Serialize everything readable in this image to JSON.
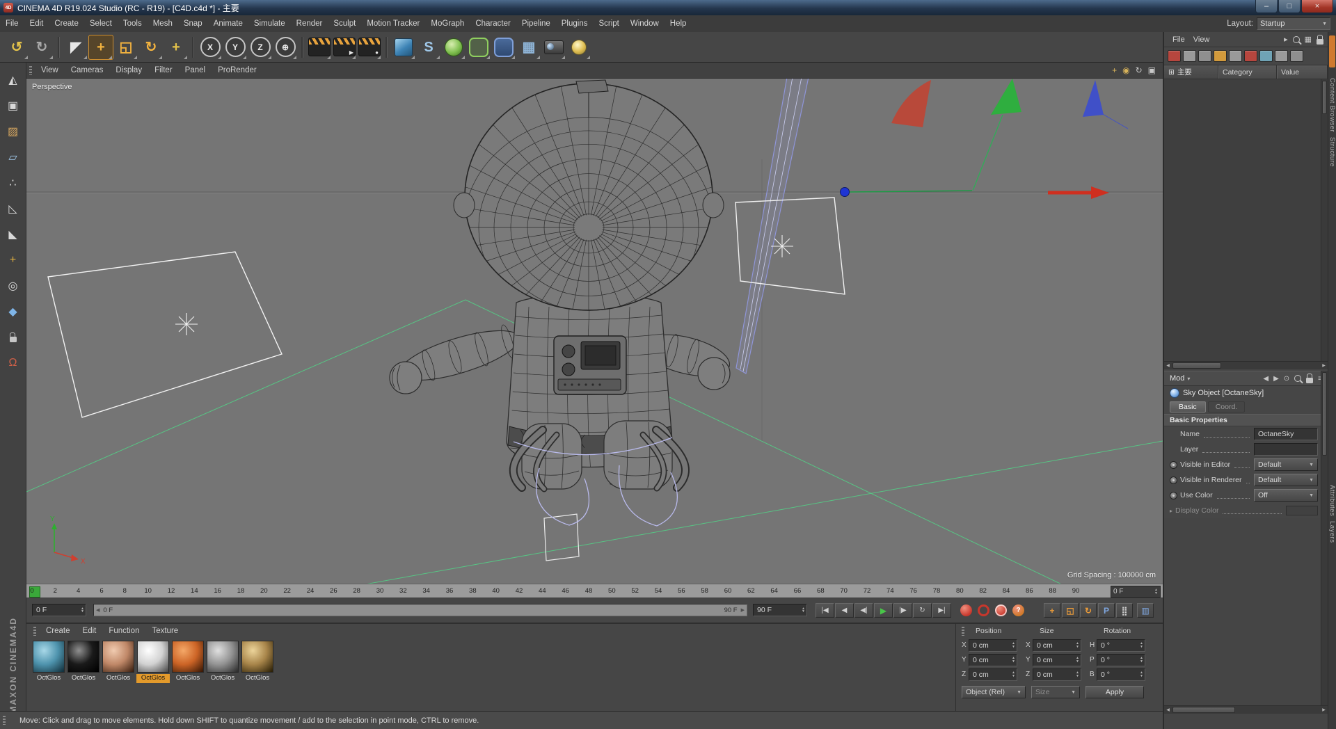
{
  "window": {
    "title": "CINEMA 4D R19.024 Studio (RC - R19) - [C4D.c4d *] - 主要",
    "app_icon": "4D",
    "controls": [
      {
        "name": "minimize-button",
        "glyph": "–"
      },
      {
        "name": "maximize-button",
        "glyph": "□"
      },
      {
        "name": "close-button",
        "glyph": "×",
        "close": true
      }
    ]
  },
  "menu_bar": {
    "items": [
      "File",
      "Edit",
      "Create",
      "Select",
      "Tools",
      "Mesh",
      "Snap",
      "Animate",
      "Simulate",
      "Render",
      "Sculpt",
      "Motion Tracker",
      "MoGraph",
      "Character",
      "Pipeline",
      "Plugins",
      "Script",
      "Window",
      "Help"
    ],
    "layout_label": "Layout:",
    "layout_value": "Startup"
  },
  "toolbar": {
    "items": [
      {
        "name": "undo-button",
        "kind": "glyph",
        "glyph": "↺",
        "fg": "#e3c24a"
      },
      {
        "name": "redo-button",
        "kind": "glyph",
        "glyph": "↻",
        "fg": "#a8a8a8"
      },
      {
        "kind": "sep"
      },
      {
        "name": "live-selection-tool",
        "kind": "glyph",
        "glyph": "◤",
        "fg": "#e8e8e8"
      },
      {
        "name": "move-tool",
        "kind": "glyph",
        "glyph": "+",
        "fg": "#f2b23f",
        "active": true
      },
      {
        "name": "scale-tool",
        "kind": "glyph",
        "glyph": "◱",
        "fg": "#f2b23f"
      },
      {
        "name": "rotate-tool",
        "kind": "glyph",
        "glyph": "↻",
        "fg": "#f2b23f"
      },
      {
        "name": "last-used-tool-button",
        "kind": "glyph",
        "glyph": "+",
        "fg": "#e3c24a"
      },
      {
        "kind": "sep"
      },
      {
        "name": "lock-x-axis-button",
        "kind": "circle",
        "glyph": "X"
      },
      {
        "name": "lock-y-axis-button",
        "kind": "circle",
        "glyph": "Y"
      },
      {
        "name": "lock-z-axis-button",
        "kind": "circle",
        "glyph": "Z"
      },
      {
        "name": "coordinate-system-button",
        "kind": "circle",
        "glyph": "⊕"
      },
      {
        "kind": "sep"
      },
      {
        "name": "render-view-button",
        "kind": "clapper",
        "sub": ""
      },
      {
        "name": "render-picture-viewer-button",
        "kind": "clapper",
        "sub": "▶"
      },
      {
        "name": "render-settings-button",
        "kind": "clapper",
        "sub": "●"
      },
      {
        "kind": "sep"
      },
      {
        "name": "add-cube-button",
        "kind": "cube"
      },
      {
        "name": "spline-pen-button",
        "kind": "glyph",
        "glyph": "S",
        "fg": "#9fc7e8"
      },
      {
        "name": "subdivision-surface-button",
        "kind": "sphere-green"
      },
      {
        "name": "generator-button",
        "kind": "cage-green"
      },
      {
        "name": "deformer-button",
        "kind": "cage-blue"
      },
      {
        "name": "floor-button",
        "kind": "glyph",
        "glyph": "▦",
        "fg": "#8fb5d8"
      },
      {
        "name": "camera-button",
        "kind": "camera"
      },
      {
        "name": "light-button",
        "kind": "bulb"
      }
    ]
  },
  "left_palette": {
    "items": [
      {
        "name": "make-editable-button",
        "glyph": "◭",
        "fg": "#d8d8d8"
      },
      {
        "name": "model-mode-button",
        "glyph": "▣",
        "fg": "#d8d8d8"
      },
      {
        "name": "texture-mode-button",
        "glyph": "▨",
        "fg": "#d8a860"
      },
      {
        "name": "workplane-mode-button",
        "glyph": "▱",
        "fg": "#9fc7e8"
      },
      {
        "name": "points-mode-button",
        "glyph": "∴",
        "fg": "#d8d8d8"
      },
      {
        "name": "edges-mode-button",
        "glyph": "◺",
        "fg": "#d8d8d8"
      },
      {
        "name": "polygons-mode-button",
        "glyph": "◣",
        "fg": "#d8d8d8"
      },
      {
        "name": "enable-axis-button",
        "glyph": "+",
        "fg": "#e0b040"
      },
      {
        "name": "viewport-solo-button",
        "glyph": "◎",
        "fg": "#d8d8d8"
      },
      {
        "name": "snap-button",
        "glyph": "◆",
        "fg": "#7fb5e8"
      },
      {
        "name": "lock-workplane-button",
        "kind": "lock"
      },
      {
        "name": "magnet-snap-button",
        "glyph": "Ω",
        "fg": "#d06048"
      }
    ]
  },
  "viewport": {
    "menus": [
      "View",
      "Cameras",
      "Display",
      "Filter",
      "Panel",
      "ProRender"
    ],
    "corner_icons": [
      {
        "name": "pan-view-icon",
        "glyph": "+",
        "fg": "#d8b35a"
      },
      {
        "name": "zoom-view-icon",
        "glyph": "◉",
        "fg": "#d8b35a"
      },
      {
        "name": "rotate-view-icon",
        "glyph": "↻",
        "fg": "#c9c9c9"
      },
      {
        "name": "toggle-panel-icon",
        "glyph": "▣",
        "fg": "#c9c9c9"
      }
    ],
    "label": "Perspective",
    "grid_spacing": "Grid Spacing : 100000 cm",
    "axis_labels": {
      "x": "X",
      "y": "Y"
    },
    "colors": {
      "background": "#757575",
      "grid_green": "#57c584",
      "wireframe": "#2c2c2c",
      "light_outline": "#f2f2f2",
      "selection_purple": "#b9baec",
      "axis_red": "#cf2f1f",
      "axis_green": "#1e9a46",
      "axis_blue": "#1f35d4"
    }
  },
  "object_manager": {
    "menus": [
      "File",
      "View"
    ],
    "top_icons": [
      {
        "name": "forward-icon",
        "glyph": "▸"
      },
      {
        "name": "search-icon",
        "kind": "magnifier"
      },
      {
        "name": "panel-grid-icon",
        "glyph": "▦"
      },
      {
        "name": "lock-icon",
        "kind": "lock"
      }
    ],
    "bookmark_colors": [
      "#b7463e",
      "#9a9a9a",
      "#8f8f8f",
      "#d29a3c",
      "#9a9a9a",
      "#b7463e",
      "#6fa3b5",
      "#9a9a9a",
      "#8f8f8f"
    ],
    "tab_icon": "⊞",
    "tab_label": "主要",
    "columns": [
      "Category",
      "Value"
    ]
  },
  "attribute_manager": {
    "mode_label": "Mod",
    "mode_arrow": "▾",
    "header_icons": [
      {
        "name": "history-back-icon",
        "glyph": "◀"
      },
      {
        "name": "history-forward-icon",
        "glyph": "▶"
      },
      {
        "name": "pin-icon",
        "glyph": "⊙"
      },
      {
        "name": "search-icon",
        "kind": "magnifier"
      },
      {
        "name": "lock-icon",
        "kind": "lock"
      },
      {
        "name": "menu-icon",
        "glyph": "≡"
      }
    ],
    "object_label": "Sky Object [OctaneSky]",
    "tabs": [
      "Basic",
      "Coord."
    ],
    "active_tab": 0,
    "section_label": "Basic Properties",
    "rows": [
      {
        "label": "Name",
        "control": "text",
        "value": "OctaneSky"
      },
      {
        "label": "Layer",
        "control": "text",
        "value": ""
      },
      {
        "label": "Visible in Editor",
        "radio": true,
        "control": "dropdown",
        "value": "Default"
      },
      {
        "label": "Visible in Renderer",
        "radio": true,
        "control": "dropdown",
        "value": "Default"
      },
      {
        "label": "Use Color",
        "radio": true,
        "control": "dropdown",
        "value": "Off"
      },
      {
        "label": "Display Color",
        "expander": true,
        "disabled": true,
        "control": "color",
        "value": ""
      }
    ]
  },
  "right_tabs": {
    "top": [
      "Content Browser",
      "Structure"
    ],
    "bottom": [
      "Attributes",
      "Layers"
    ]
  },
  "timeline": {
    "min": 0,
    "max": 90,
    "label_step": 2,
    "unit": "F",
    "ruler_field": "0 F",
    "current": "0 F",
    "end": "90 F",
    "range_start": "0 F",
    "range_end": "90 F",
    "marker_color": "#3aa83a"
  },
  "transport": {
    "buttons": [
      {
        "name": "goto-start-button",
        "glyph": "|◀"
      },
      {
        "name": "play-backwards-button",
        "glyph": "◀"
      },
      {
        "name": "prev-frame-button",
        "glyph": "◀|"
      },
      {
        "name": "play-button",
        "glyph": "▶",
        "fg": "#49c549"
      },
      {
        "name": "next-frame-button",
        "glyph": "|▶"
      },
      {
        "name": "loop-button",
        "glyph": "↻"
      },
      {
        "name": "goto-end-button",
        "glyph": "▶|"
      }
    ]
  },
  "record": {
    "buttons": [
      {
        "name": "record-keyframe-button",
        "kind": "ball",
        "color": "#c8372c"
      },
      {
        "name": "autokeying-button",
        "kind": "ring",
        "color": "#c8372c"
      },
      {
        "name": "record-options-button",
        "kind": "ball-dot",
        "color": "#c8372c"
      },
      {
        "name": "keying-help-button",
        "kind": "ball",
        "color": "#d07a2a",
        "glyph": "?"
      }
    ]
  },
  "key_toggles": {
    "buttons": [
      {
        "name": "key-position-toggle",
        "glyph": "+",
        "fg": "#e89a3a"
      },
      {
        "name": "key-scale-toggle",
        "glyph": "◱",
        "fg": "#e89a3a"
      },
      {
        "name": "key-rotation-toggle",
        "glyph": "↻",
        "fg": "#e89a3a"
      },
      {
        "name": "key-parameter-toggle",
        "glyph": "P",
        "fg": "#7fa7e0"
      },
      {
        "name": "key-pla-toggle",
        "glyph": "⣿",
        "fg": "#cfcfcf"
      }
    ],
    "mode_button": {
      "name": "timeline-mode-button",
      "glyph": "▥",
      "fg": "#7fa7e0"
    }
  },
  "materials": {
    "menus": [
      "Create",
      "Edit",
      "Function",
      "Texture"
    ],
    "selected_index": 3,
    "items": [
      {
        "label": "OctGlos",
        "hi": "#a8d8e8",
        "base": "#4e93ad",
        "lo": "#14323e"
      },
      {
        "label": "OctGlos",
        "hi": "#909090",
        "base": "#1a1a1a",
        "lo": "#000000"
      },
      {
        "label": "OctGlos",
        "hi": "#f0cbb0",
        "base": "#c08868",
        "lo": "#3e2212"
      },
      {
        "label": "OctGlos",
        "hi": "#ffffff",
        "base": "#d2d2d2",
        "lo": "#4e4e4e"
      },
      {
        "label": "OctGlos",
        "hi": "#f4a868",
        "base": "#cc6426",
        "lo": "#3c1a06"
      },
      {
        "label": "OctGlos",
        "hi": "#e0e0e0",
        "base": "#949494",
        "lo": "#303030"
      },
      {
        "label": "OctGlos",
        "hi": "#ecd49a",
        "base": "#a8854a",
        "lo": "#2e2208"
      }
    ]
  },
  "coordinates": {
    "groups": [
      {
        "title": "Position",
        "rows": [
          {
            "axis": "X",
            "value": "0 cm"
          },
          {
            "axis": "Y",
            "value": "0 cm"
          },
          {
            "axis": "Z",
            "value": "0 cm"
          }
        ]
      },
      {
        "title": "Size",
        "rows": [
          {
            "axis": "X",
            "value": "0 cm"
          },
          {
            "axis": "Y",
            "value": "0 cm"
          },
          {
            "axis": "Z",
            "value": "0 cm"
          }
        ]
      },
      {
        "title": "Rotation",
        "rows": [
          {
            "axis": "H",
            "value": "0 °"
          },
          {
            "axis": "P",
            "value": "0 °"
          },
          {
            "axis": "B",
            "value": "0 °"
          }
        ]
      }
    ],
    "object_mode": "Object (Rel)",
    "size_mode": "Size",
    "apply_label": "Apply"
  },
  "status_bar": {
    "text": "Move: Click and drag to move elements. Hold down SHIFT to quantize movement / add to the selection in point mode, CTRL to remove."
  },
  "branding": {
    "vertical_text": "MAXON CINEMA4D"
  }
}
